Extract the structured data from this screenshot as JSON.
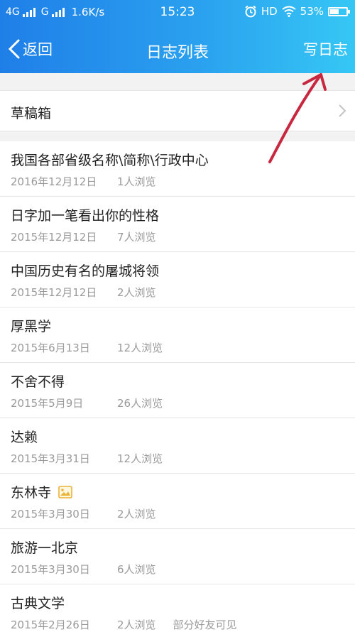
{
  "status_bar": {
    "network1": "4G",
    "network2": "G",
    "speed": "1.6K/s",
    "time": "15:23",
    "hd": "HD",
    "battery": "53%",
    "battery_level": 0.53,
    "icons": [
      "alarm-icon",
      "wifi-icon",
      "battery-icon"
    ]
  },
  "nav": {
    "back_label": "返回",
    "title": "日志列表",
    "write_label": "写日志"
  },
  "drafts_label": "草稿箱",
  "colors": {
    "header_start": "#1f7fe8",
    "header_end": "#36c7f5",
    "annotation_arrow": "#c8283f"
  },
  "entries": [
    {
      "title": "我国各部省级名称\\简称\\行政中心",
      "date": "2016年12月12日",
      "views": "1人浏览",
      "extra": ""
    },
    {
      "title": "日字加一笔看出你的性格",
      "date": "2015年12月12日",
      "views": "7人浏览",
      "extra": ""
    },
    {
      "title": "中国历史有名的屠城将领",
      "date": "2015年12月12日",
      "views": "2人浏览",
      "extra": ""
    },
    {
      "title": "厚黑学",
      "date": "2015年6月13日",
      "views": "12人浏览",
      "extra": ""
    },
    {
      "title": "不舍不得",
      "date": "2015年5月9日",
      "views": "26人浏览",
      "extra": ""
    },
    {
      "title": "达赖",
      "date": "2015年3月31日",
      "views": "12人浏览",
      "extra": ""
    },
    {
      "title": "东林寺",
      "date": "2015年3月30日",
      "views": "2人浏览",
      "extra": "",
      "icon": "photo-icon"
    },
    {
      "title": "旅游一北京",
      "date": "2015年3月30日",
      "views": "6人浏览",
      "extra": ""
    },
    {
      "title": "古典文学",
      "date": "2015年2月26日",
      "views": "2人浏览",
      "extra": "部分好友可见"
    }
  ]
}
